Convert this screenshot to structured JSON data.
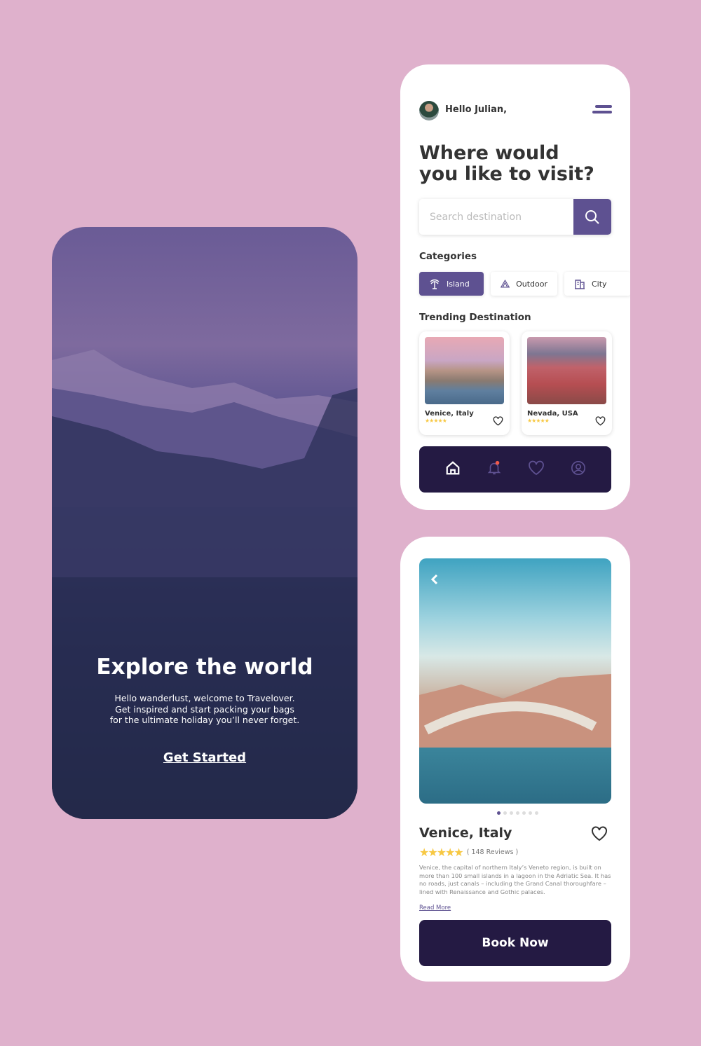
{
  "welcome": {
    "title": "Explore the world",
    "body": "Hello wanderlust, welcome to Travelover. Get inspired and start packing your bags for the ultimate holiday you’ll never forget.",
    "cta": "Get Started"
  },
  "home": {
    "greeting": "Hello Julian,",
    "heading_line1": "Where would",
    "heading_line2": "you like to visit?",
    "search_placeholder": "Search destination",
    "categories_label": "Categories",
    "categories": [
      {
        "label": "Island",
        "icon": "palm-tree-icon",
        "active": true
      },
      {
        "label": "Outdoor",
        "icon": "tent-icon",
        "active": false
      },
      {
        "label": "City",
        "icon": "building-icon",
        "active": false
      }
    ],
    "trending_label": "Trending Destination",
    "trending": [
      {
        "name": "Venice, Italy",
        "rating": 5
      },
      {
        "name": "Nevada, USA",
        "rating": 5
      }
    ],
    "nav": [
      "home-icon",
      "bell-icon",
      "heart-icon",
      "user-icon"
    ]
  },
  "detail": {
    "title": "Venice, Italy",
    "rating": 5,
    "reviews": "( 148 Reviews )",
    "description": "Venice, the capital of northern Italy’s Veneto region, is built on more than 100 small islands in a lagoon in the Adriatic Sea. It has no roads, just canals – including the Grand Canal thoroughfare – lined with Renaissance and Gothic palaces.",
    "read_more": "Read More",
    "book": "Book Now",
    "carousel_pages": 7,
    "carousel_index": 1
  },
  "colors": {
    "background": "#dfb1cc",
    "accent": "#5e5191",
    "dark": "#241a43",
    "star": "#f7c843",
    "notification": "#f25a4a"
  }
}
